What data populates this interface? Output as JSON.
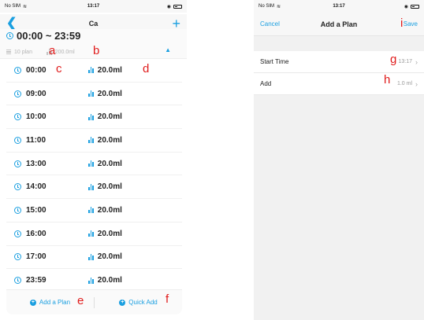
{
  "left": {
    "status": {
      "carrier": "No SIM",
      "time": "13:17"
    },
    "nav": {
      "title": "Ca",
      "back_glyph": "❮",
      "add_glyph": "+"
    },
    "summary": {
      "range": "00:00 ~ 23:59",
      "plan_count": "10 plan",
      "total_amount": "200.0ml"
    },
    "plans": [
      {
        "time": "00:00",
        "amount": "20.0ml"
      },
      {
        "time": "09:00",
        "amount": "20.0ml"
      },
      {
        "time": "10:00",
        "amount": "20.0ml"
      },
      {
        "time": "11:00",
        "amount": "20.0ml"
      },
      {
        "time": "13:00",
        "amount": "20.0ml"
      },
      {
        "time": "14:00",
        "amount": "20.0ml"
      },
      {
        "time": "15:00",
        "amount": "20.0ml"
      },
      {
        "time": "16:00",
        "amount": "20.0ml"
      },
      {
        "time": "17:00",
        "amount": "20.0ml"
      },
      {
        "time": "23:59",
        "amount": "20.0ml"
      }
    ],
    "bottom": {
      "add_plan": "Add a Plan",
      "quick_add": "Quick Add"
    }
  },
  "right": {
    "status": {
      "carrier": "No SIM",
      "time": "13:17"
    },
    "nav": {
      "cancel": "Cancel",
      "title": "Add a Plan",
      "save": "Save"
    },
    "rows": [
      {
        "label": "Start Time",
        "value": "13:17"
      },
      {
        "label": "Add",
        "value": "1.0 ml"
      }
    ]
  },
  "markers": {
    "a": "a",
    "b": "b",
    "c": "c",
    "d": "d",
    "e": "e",
    "f": "f",
    "g": "g",
    "h": "h",
    "i": "i"
  },
  "colors": {
    "accent": "#1a9fe0",
    "marker": "#e01b1b"
  }
}
